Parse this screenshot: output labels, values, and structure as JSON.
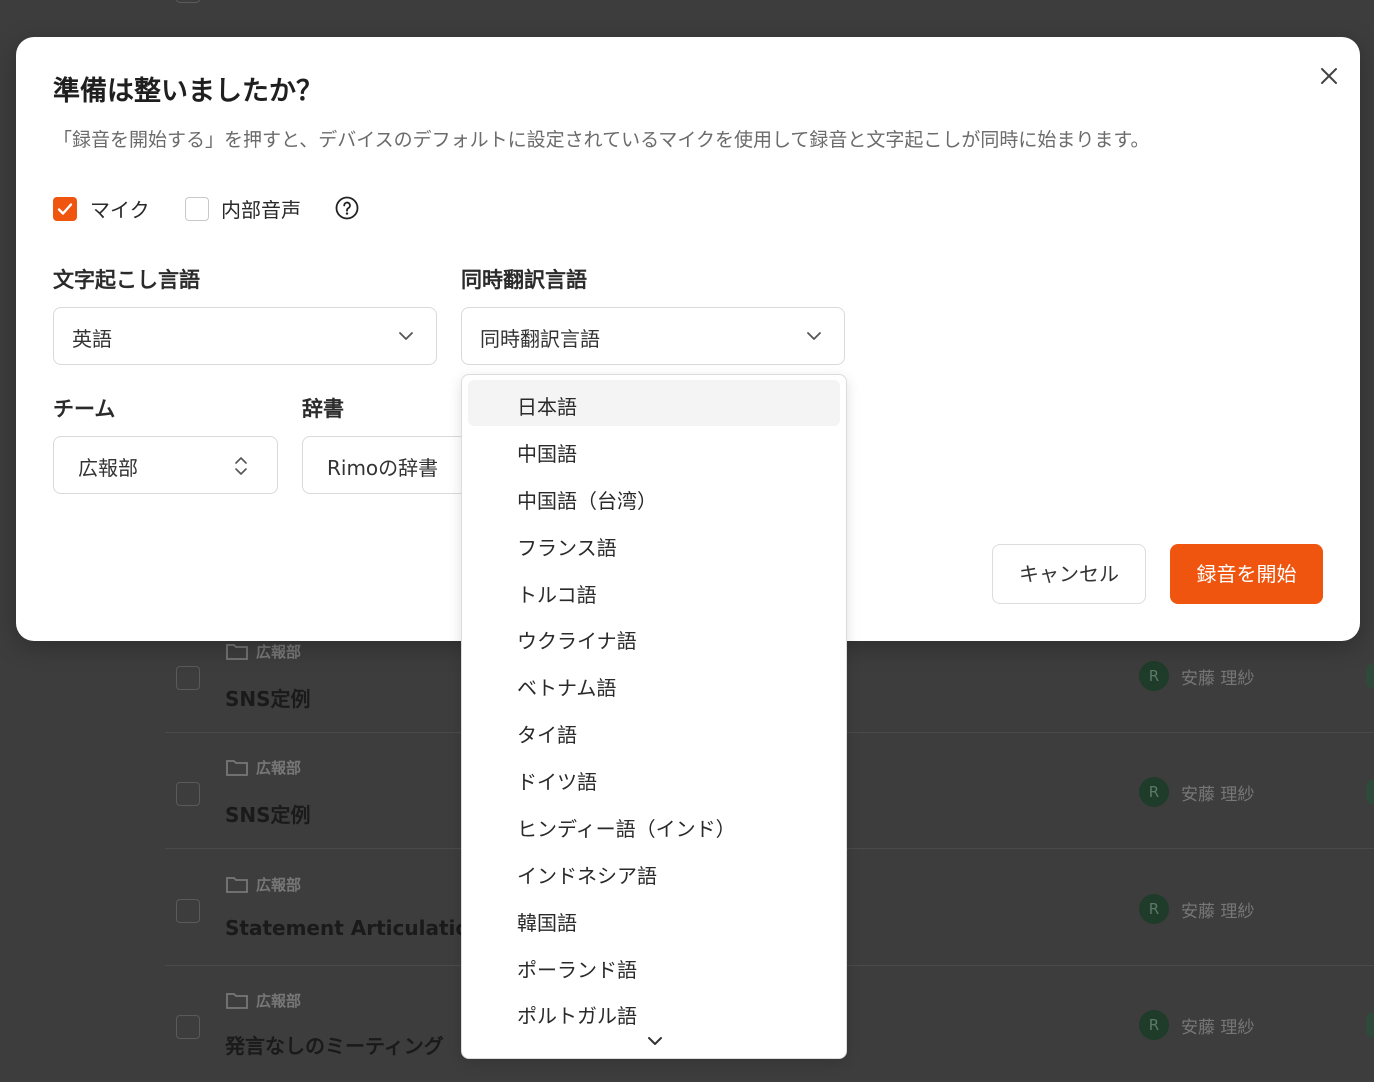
{
  "background": {
    "rows": [
      {
        "team": "広報部",
        "title": "SNS定例",
        "owner": "安藤 理紗",
        "avatar": "R"
      },
      {
        "team": "広報部",
        "title": "SNS定例",
        "owner": "安藤 理紗",
        "avatar": "R"
      },
      {
        "team": "広報部",
        "title": "Statement Articulation",
        "owner": "安藤 理紗",
        "avatar": "R"
      },
      {
        "team": "広報部",
        "title": "発言なしのミーティング",
        "owner": "安藤 理紗",
        "avatar": "R"
      }
    ]
  },
  "modal": {
    "title": "準備は整いましたか？",
    "description": "「録音を開始する」を押すと、デバイスのデフォルトに設定されているマイクを使用して録音と文字起こしが同時に始まります。",
    "sources": {
      "mic_label": "マイク",
      "mic_checked": true,
      "internal_label": "内部音声",
      "internal_checked": false
    },
    "transcription": {
      "label": "文字起こし言語",
      "value": "英語"
    },
    "translation": {
      "label": "同時翻訳言語",
      "placeholder": "同時翻訳言語"
    },
    "team": {
      "label": "チーム",
      "value": "広報部"
    },
    "dictionary": {
      "label": "辞書",
      "value": "Rimoの辞書"
    },
    "cancel_label": "キャンセル",
    "start_label": "録音を開始",
    "accent_color": "#f0550f"
  },
  "dropdown": {
    "options": [
      "日本語",
      "中国語",
      "中国語（台湾）",
      "フランス語",
      "トルコ語",
      "ウクライナ語",
      "ベトナム語",
      "タイ語",
      "ドイツ語",
      "ヒンディー語（インド）",
      "インドネシア語",
      "韓国語",
      "ポーランド語",
      "ポルトガル語"
    ],
    "highlighted_index": 0
  }
}
